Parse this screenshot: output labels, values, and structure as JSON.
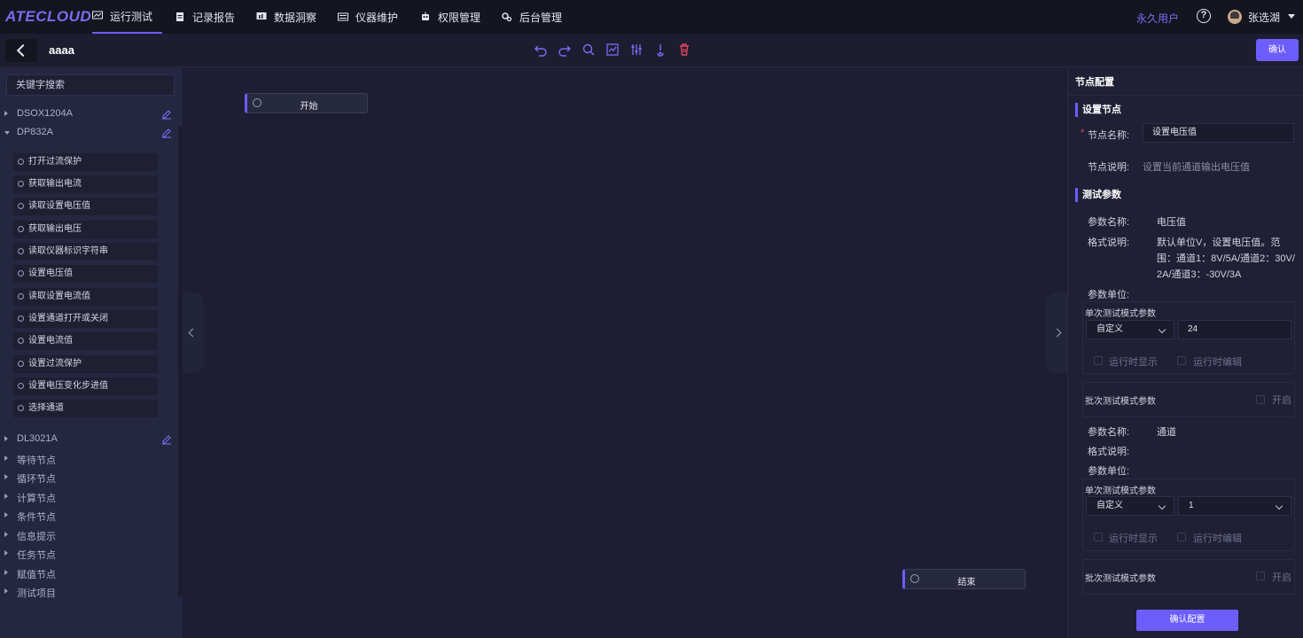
{
  "app": {
    "logo": "ATECLOUD"
  },
  "nav": {
    "items": [
      {
        "label": "运行测试"
      },
      {
        "label": "记录报告"
      },
      {
        "label": "数据洞察"
      },
      {
        "label": "仪器维护"
      },
      {
        "label": "权限管理"
      },
      {
        "label": "后台管理"
      }
    ],
    "active": "运行测试",
    "user_type": "永久用户",
    "help": "?",
    "username": "张选湖"
  },
  "toolbar": {
    "flow_name": "aaaa",
    "confirm_label": "确认",
    "icons": [
      "undo-icon",
      "redo-icon",
      "zoom-icon",
      "chart-icon",
      "adjust-icon",
      "run-icon",
      "delete-icon"
    ]
  },
  "sidebar": {
    "search_placeholder": "关键字搜索",
    "instruments": [
      {
        "label": "DSOX1204A"
      },
      {
        "label": "DP832A"
      },
      {
        "label": "DL3021A"
      }
    ],
    "commands": [
      "打开过流保护",
      "获取输出电流",
      "读取设置电压值",
      "获取输出电压",
      "读取仪器标识字符串",
      "设置电压值",
      "读取设置电流值",
      "设置通道打开或关闭",
      "设置电流值",
      "设置过流保护",
      "设置电压变化步进值",
      "选择通道"
    ],
    "categories": [
      "等待节点",
      "循环节点",
      "计算节点",
      "条件节点",
      "信息提示",
      "任务节点",
      "赋值节点",
      "测试项目"
    ]
  },
  "canvas": {
    "start_node": "开始",
    "end_node": "结束"
  },
  "panel": {
    "title": "节点配置",
    "set_node_section": "设置节点",
    "node_name_label": "节点名称:",
    "node_name_value": "设置电压值",
    "node_desc_label": "节点说明:",
    "node_desc_value": "设置当前通道输出电压值",
    "params_section": "测试参数",
    "param1": {
      "name_label": "参数名称:",
      "name": "电压值",
      "format_label": "格式说明:",
      "format_lines": [
        "默认单位V，设置电压值。范",
        "围：通道1：8V/5A/通道2：30V/",
        "2A/通道3：-30V/3A"
      ],
      "unit_label": "参数单位:",
      "single_mode": "单次测试模式参数",
      "select": "自定义",
      "value": "24",
      "runtime_show": "运行时显示",
      "runtime_edit": "运行时编辑",
      "batch_mode": "批次测试模式参数",
      "enable": "开启"
    },
    "param2": {
      "name_label": "参数名称:",
      "name": "通道",
      "format_label": "格式说明:",
      "unit_label": "参数单位:",
      "single_mode": "单次测试模式参数",
      "select": "自定义",
      "value": "1",
      "runtime_show": "运行时显示",
      "runtime_edit": "运行时编辑",
      "batch_mode": "批次测试模式参数",
      "enable": "开启"
    },
    "confirm_label": "确认配置"
  }
}
